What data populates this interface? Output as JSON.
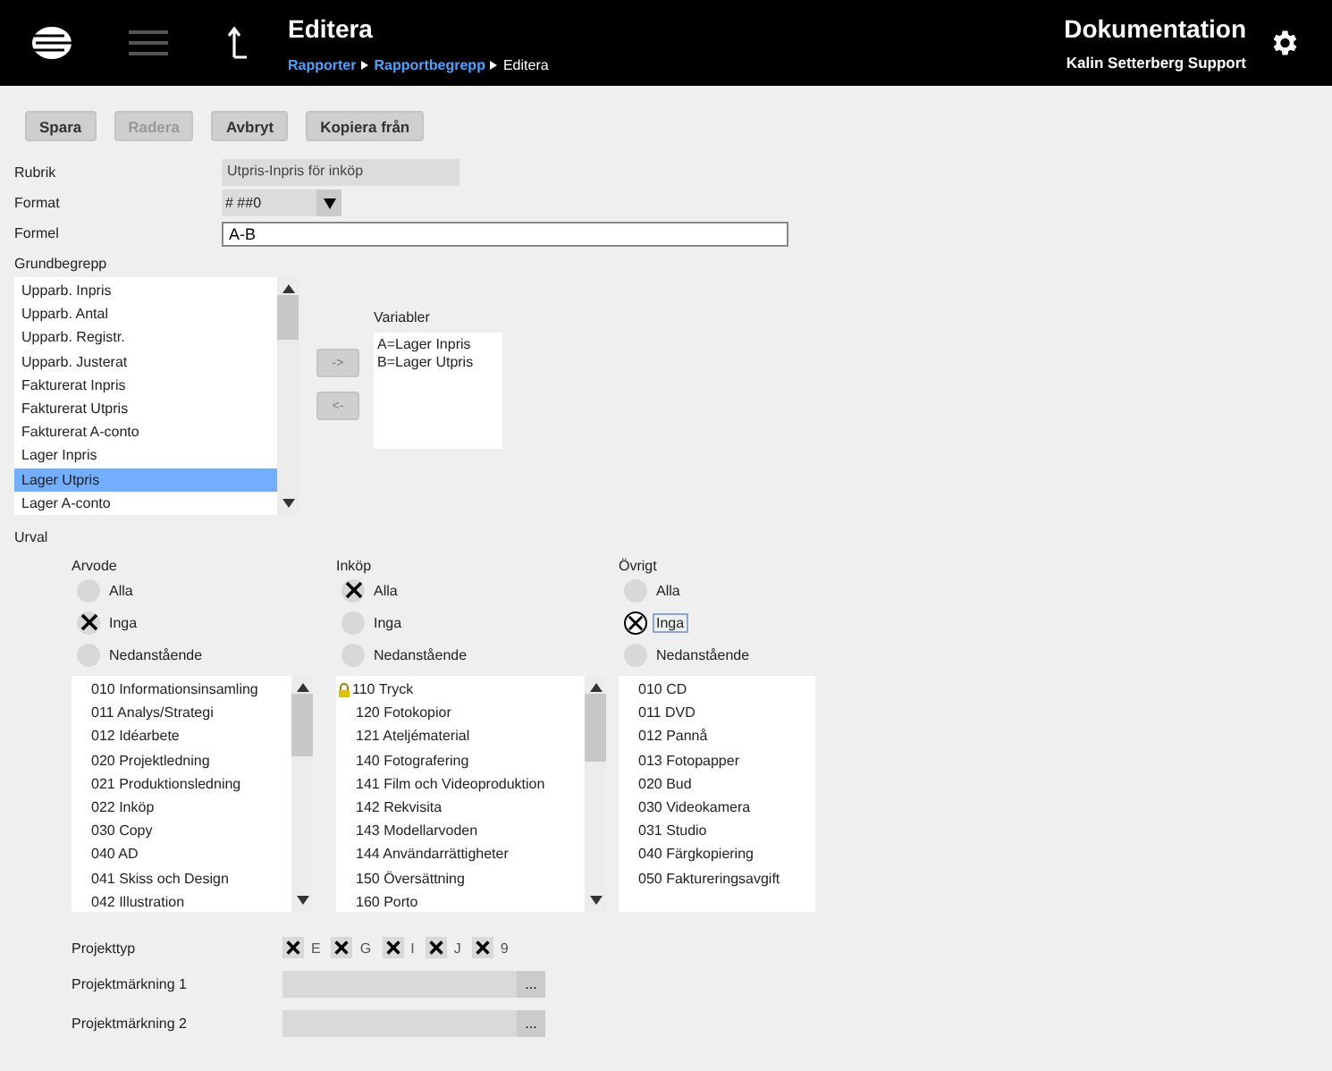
{
  "header": {
    "title": "Editera",
    "breadcrumb": [
      {
        "label": "Rapporter",
        "link": true
      },
      {
        "label": "Rapportbegrepp",
        "link": true
      },
      {
        "label": "Editera",
        "link": false
      }
    ],
    "app_title": "Dokumentation",
    "user": "Kalin Setterberg Support"
  },
  "toolbar": [
    {
      "label": "Spara",
      "disabled": false
    },
    {
      "label": "Radera",
      "disabled": true
    },
    {
      "label": "Avbryt",
      "disabled": false
    },
    {
      "label": "Kopiera från",
      "disabled": false
    }
  ],
  "fields": [
    {
      "kind": "readonly",
      "label": "Rubrik",
      "value": "Utpris-Inpris för inköp"
    },
    {
      "kind": "select",
      "label": "Format",
      "value": "# ##0"
    },
    {
      "kind": "text",
      "label": "Formel",
      "value": "A-B"
    }
  ],
  "grundbegrepp": {
    "label": "Grundbegrepp",
    "items": [
      {
        "label": "Upparb. Inpris",
        "selected": false
      },
      {
        "label": "Upparb. Antal",
        "selected": false
      },
      {
        "label": "Upparb. Registr.",
        "selected": false
      },
      {
        "label": "Upparb. Justerat",
        "selected": false
      },
      {
        "label": "Fakturerat Inpris",
        "selected": false
      },
      {
        "label": "Fakturerat Utpris",
        "selected": false
      },
      {
        "label": "Fakturerat A-conto",
        "selected": false
      },
      {
        "label": "Lager Inpris",
        "selected": false
      },
      {
        "label": "Lager Utpris",
        "selected": true
      },
      {
        "label": "Lager A-conto",
        "selected": false
      }
    ]
  },
  "move_buttons": [
    "->",
    "<-"
  ],
  "variabler": {
    "label": "Variabler",
    "items": [
      "A=Lager Inpris",
      "B=Lager Utpris"
    ]
  },
  "urval": {
    "label": "Urval",
    "groups": [
      {
        "title": "Arvode",
        "scrollable": true,
        "options": [
          {
            "label": "Alla",
            "selected": false,
            "focused": false
          },
          {
            "label": "Inga",
            "selected": true,
            "focused": false
          },
          {
            "label": "Nedanstående",
            "selected": false,
            "focused": false
          }
        ],
        "items": [
          {
            "label": "010 Informationsinsamling",
            "locked": false
          },
          {
            "label": "011  Analys/Strategi",
            "locked": false
          },
          {
            "label": "012 Idéarbete",
            "locked": false
          },
          {
            "label": "020 Projektledning",
            "locked": false
          },
          {
            "label": "021  Produktionsledning",
            "locked": false
          },
          {
            "label": "022 Inköp",
            "locked": false
          },
          {
            "label": "030 Copy",
            "locked": false
          },
          {
            "label": "040 AD",
            "locked": false
          },
          {
            "label": "041  Skiss och Design",
            "locked": false
          },
          {
            "label": "042 Illustration",
            "locked": false
          }
        ]
      },
      {
        "title": "Inköp",
        "scrollable": true,
        "options": [
          {
            "label": "Alla",
            "selected": true,
            "focused": false
          },
          {
            "label": "Inga",
            "selected": false,
            "focused": false
          },
          {
            "label": "Nedanstående",
            "selected": false,
            "focused": false
          }
        ],
        "items": [
          {
            "label": "110 Tryck",
            "locked": true
          },
          {
            "label": "120 Fotokopior",
            "locked": false
          },
          {
            "label": "121  Ateljématerial",
            "locked": false
          },
          {
            "label": "140 Fotografering",
            "locked": false
          },
          {
            "label": "141  Film och Videoproduktion",
            "locked": false
          },
          {
            "label": "142 Rekvisita",
            "locked": false
          },
          {
            "label": "143 Modellarvoden",
            "locked": false
          },
          {
            "label": "144 Användarrättigheter",
            "locked": false
          },
          {
            "label": "150 Översättning",
            "locked": false
          },
          {
            "label": "160 Porto",
            "locked": false
          }
        ]
      },
      {
        "title": "Övrigt",
        "scrollable": false,
        "options": [
          {
            "label": "Alla",
            "selected": false,
            "focused": false
          },
          {
            "label": "Inga",
            "selected": true,
            "focused": true
          },
          {
            "label": "Nedanstående",
            "selected": false,
            "focused": false
          }
        ],
        "items": [
          {
            "label": "010 CD",
            "locked": false
          },
          {
            "label": "011  DVD",
            "locked": false
          },
          {
            "label": "012 Pannå",
            "locked": false
          },
          {
            "label": "013 Fotopapper",
            "locked": false
          },
          {
            "label": "020 Bud",
            "locked": false
          },
          {
            "label": "030 Videokamera",
            "locked": false
          },
          {
            "label": "031  Studio",
            "locked": false
          },
          {
            "label": "040 Färgkopiering",
            "locked": false
          },
          {
            "label": "050 Faktureringsavgift",
            "locked": false
          }
        ]
      }
    ]
  },
  "projekttyp": {
    "label": "Projekttyp",
    "options": [
      {
        "label": "E",
        "checked": true
      },
      {
        "label": "G",
        "checked": true
      },
      {
        "label": "I",
        "checked": true
      },
      {
        "label": "J",
        "checked": true
      },
      {
        "label": "9",
        "checked": true
      }
    ]
  },
  "markings": [
    {
      "label": "Projektmärkning 1",
      "button": "..."
    },
    {
      "label": "Projektmärkning 2",
      "button": "..."
    }
  ]
}
